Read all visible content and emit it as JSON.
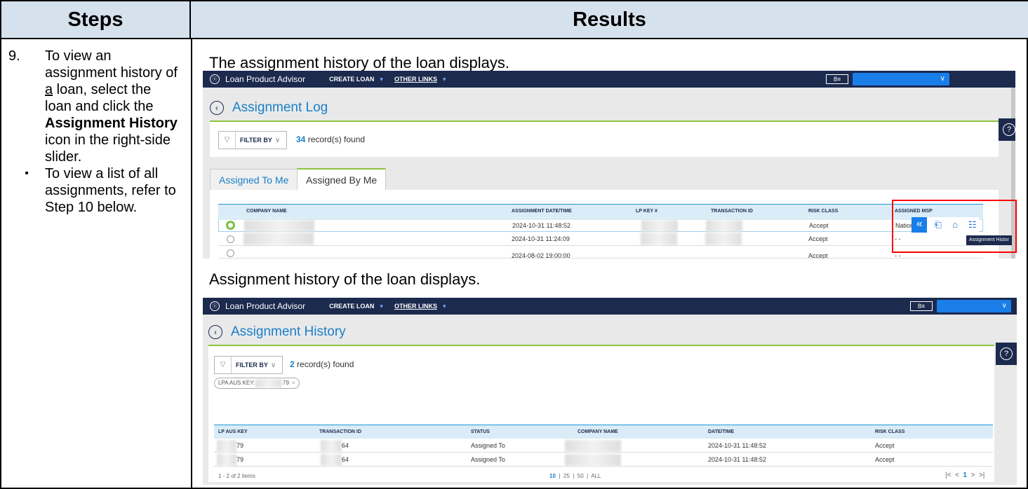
{
  "table": {
    "header_steps": "Steps",
    "header_results": "Results"
  },
  "steps": {
    "number": "9.",
    "text_before": "To view an assignment history of ",
    "text_underlined": "a",
    "text_middle": " loan, select the loan and click the ",
    "text_bold": "Assignment History",
    "text_after": " icon in the right-side slider.",
    "bullet": "•",
    "bullet_text": "To view a list of all assignments, refer to Step 10 below."
  },
  "results": {
    "caption_1": "The assignment history of the loan displays.",
    "caption_2": "Assignment history of the loan displays."
  },
  "screenshot_1": {
    "nav": {
      "logo": "ⓢ",
      "app_name": "Loan Product Advisor",
      "create_loan": "CREATE LOAN",
      "other_links": "OTHER LINKS",
      "caret": "▾",
      "profile_icon": "8≡",
      "user_caret": "∨"
    },
    "page_title": "Assignment Log",
    "back_icon": "‹",
    "filter": {
      "funnel_icon": "▽",
      "label": "FILTER BY",
      "caret": "∨"
    },
    "records_count": "34",
    "records_suffix": " record(s) found",
    "help_icon": "?",
    "tabs": [
      "Assigned To Me",
      "Assigned By Me"
    ],
    "columns": [
      "COMPANY NAME",
      "ASSIGNMENT DATE/TIME",
      "LP KEY #",
      "TRANSACTION ID",
      "RISK CLASS",
      "ASSIGNED MSP"
    ],
    "rows": [
      {
        "datetime": "2024-10-31 11:48:52",
        "risk": "Accept",
        "msp": "Nation"
      },
      {
        "datetime": "2024-10-31 11:24:09",
        "risk": "Accept",
        "msp": "- -"
      },
      {
        "datetime": "2024-08-02 19:00:00",
        "risk": "Accept",
        "msp": "- -"
      }
    ],
    "slider": {
      "collapse_icon": "«",
      "document_icon": "⎗",
      "unlock_icon": "⌂",
      "checklist_icon": "☷"
    },
    "tooltip": "Assignment Histor"
  },
  "screenshot_2": {
    "nav": {
      "logo": "ⓢ",
      "app_name": "Loan Product Advisor",
      "create_loan": "CREATE LOAN",
      "other_links": "OTHER LINKS",
      "caret": "▾",
      "profile_icon": "8≡",
      "user_caret": "∨"
    },
    "page_title": "Assignment History",
    "back_icon": "‹",
    "filter": {
      "funnel_icon": "▽",
      "label": "FILTER BY",
      "caret": "∨"
    },
    "records_count": "2",
    "records_suffix": " record(s) found",
    "chip_label": "LPA AUS KEY:",
    "chip_value": "79",
    "chip_close": "×",
    "help_icon": "?",
    "columns": [
      "LP AUS KEY",
      "TRANSACTION ID",
      "STATUS",
      "COMPANY NAME",
      "DATE/TIME",
      "RISK CLASS"
    ],
    "rows": [
      {
        "key": "79",
        "txn": "64",
        "status": "Assigned To",
        "datetime": "2024-10-31 11:48:52",
        "risk": "Accept"
      },
      {
        "key": "79",
        "txn": "64",
        "status": "Assigned To",
        "datetime": "2024-10-31 11:48:52",
        "risk": "Accept"
      }
    ],
    "items_text": "1 - 2 of 2 items",
    "page_sizes": [
      "10",
      "25",
      "50",
      "ALL"
    ],
    "page_sep": "|",
    "pager_nav": {
      "first": "|<",
      "prev": "<",
      "current": "1",
      "next": ">",
      "last": ">|"
    }
  }
}
